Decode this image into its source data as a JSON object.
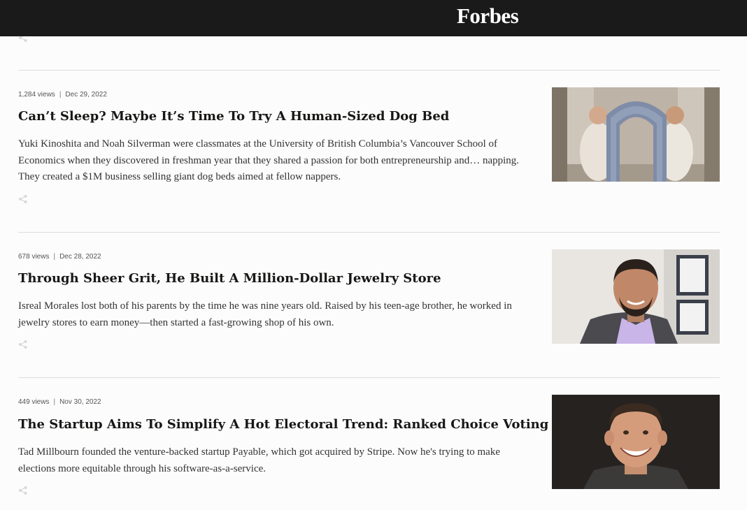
{
  "header": {
    "logo_text": "Forbes"
  },
  "articles": [
    {
      "views": "1,284 views",
      "date": "Dec 29, 2022",
      "title": "Can’t Sleep? Maybe It’s Time To Try A Human-Sized Dog Bed",
      "description": "Yuki Kinoshita and Noah Silverman were classmates at the University of British Columbia’s Vancouver School of Economics when they discovered in freshman year that they shared a passion for both entrepreneurship and… napping. They created a $1M business selling giant dog beds aimed at fellow nappers."
    },
    {
      "views": "678 views",
      "date": "Dec 28, 2022",
      "title": "Through Sheer Grit, He Built A Million-Dollar Jewelry Store",
      "description": "Isreal Morales lost both of his parents by the time he was nine years old. Raised by his teen-age brother, he worked in jewelry stores to earn money—then started a fast-growing shop of his own."
    },
    {
      "views": "449 views",
      "date": "Nov 30, 2022",
      "title": "The Startup Aims To Simplify A Hot Electoral Trend: Ranked Choice Voting",
      "description": "Tad Millbourn founded the venture-backed startup Payable, which got acquired by Stripe. Now he's trying to make elections more equitable through his software-as-a-service."
    }
  ],
  "icons": {
    "share": "share-icon",
    "logo": "forbes-logo"
  },
  "colors": {
    "header_bg": "#1a1a1a",
    "divider": "#dcdcdc",
    "title": "#181716"
  }
}
